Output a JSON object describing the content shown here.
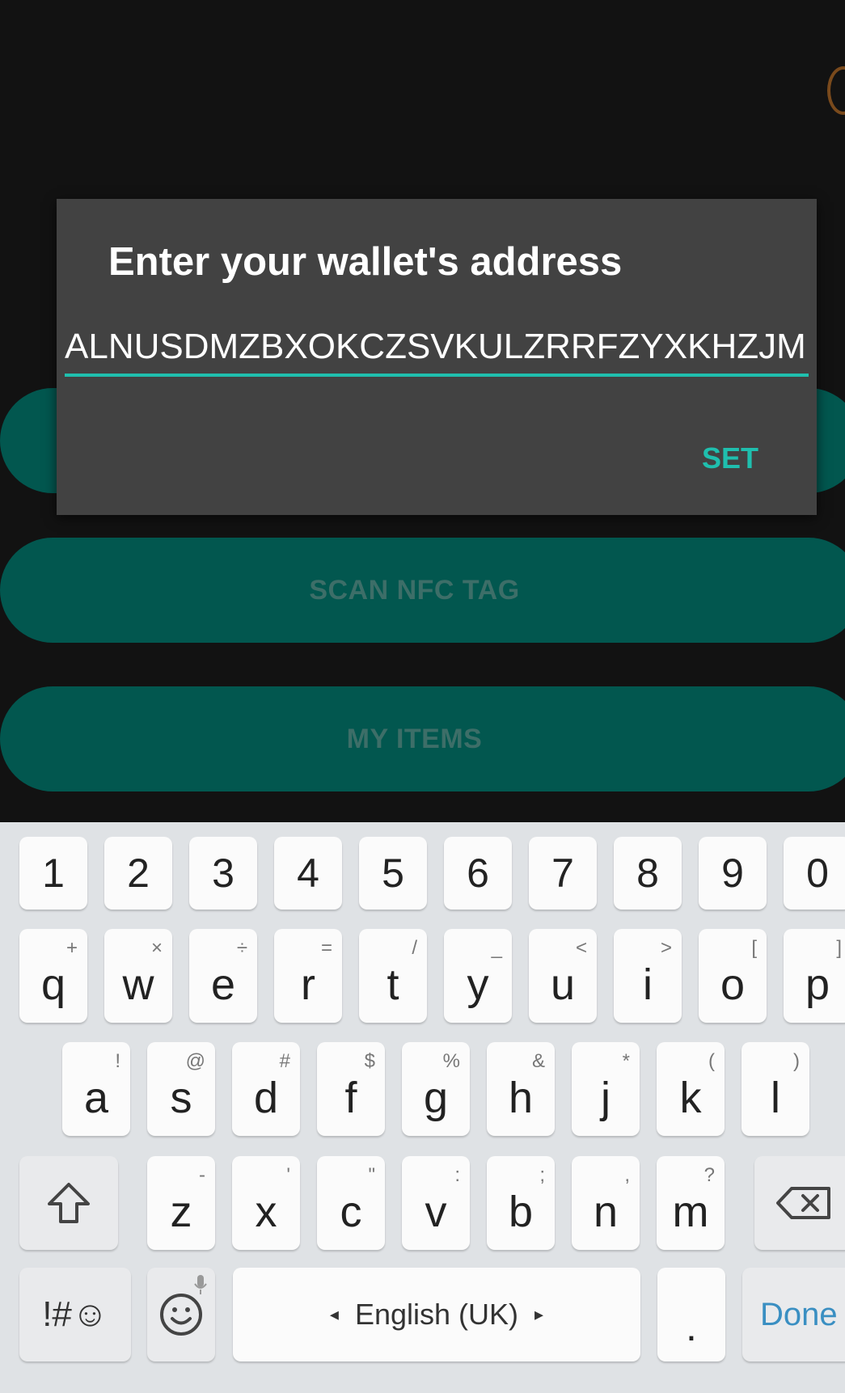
{
  "app": {
    "hidden_button_label": "",
    "scan_button_label": "SCAN NFC TAG",
    "items_button_label": "MY ITEMS"
  },
  "dialog": {
    "title": "Enter your wallet's address",
    "input_value": "ALNUSDMZBXOKCZSVKULZRRFZYXKHZJM",
    "set_label": "SET",
    "accent_color": "#1fbfae"
  },
  "keyboard": {
    "number_row": [
      "1",
      "2",
      "3",
      "4",
      "5",
      "6",
      "7",
      "8",
      "9",
      "0"
    ],
    "row1": [
      {
        "key": "q",
        "alt": "+"
      },
      {
        "key": "w",
        "alt": "×"
      },
      {
        "key": "e",
        "alt": "÷"
      },
      {
        "key": "r",
        "alt": "="
      },
      {
        "key": "t",
        "alt": "/"
      },
      {
        "key": "y",
        "alt": "_"
      },
      {
        "key": "u",
        "alt": "<"
      },
      {
        "key": "i",
        "alt": ">"
      },
      {
        "key": "o",
        "alt": "["
      },
      {
        "key": "p",
        "alt": "]"
      }
    ],
    "row2": [
      {
        "key": "a",
        "alt": "!"
      },
      {
        "key": "s",
        "alt": "@"
      },
      {
        "key": "d",
        "alt": "#"
      },
      {
        "key": "f",
        "alt": "$"
      },
      {
        "key": "g",
        "alt": "%"
      },
      {
        "key": "h",
        "alt": "&"
      },
      {
        "key": "j",
        "alt": "*"
      },
      {
        "key": "k",
        "alt": "("
      },
      {
        "key": "l",
        "alt": ")"
      }
    ],
    "row3": [
      {
        "key": "z",
        "alt": "-"
      },
      {
        "key": "x",
        "alt": "'"
      },
      {
        "key": "c",
        "alt": "\""
      },
      {
        "key": "v",
        "alt": ":"
      },
      {
        "key": "b",
        "alt": ";"
      },
      {
        "key": "n",
        "alt": ","
      },
      {
        "key": "m",
        "alt": "?"
      }
    ],
    "symbols_label": "!#☺",
    "space_label": "English (UK)",
    "period_label": ".",
    "done_label": "Done",
    "done_color": "#3a8fc2"
  }
}
